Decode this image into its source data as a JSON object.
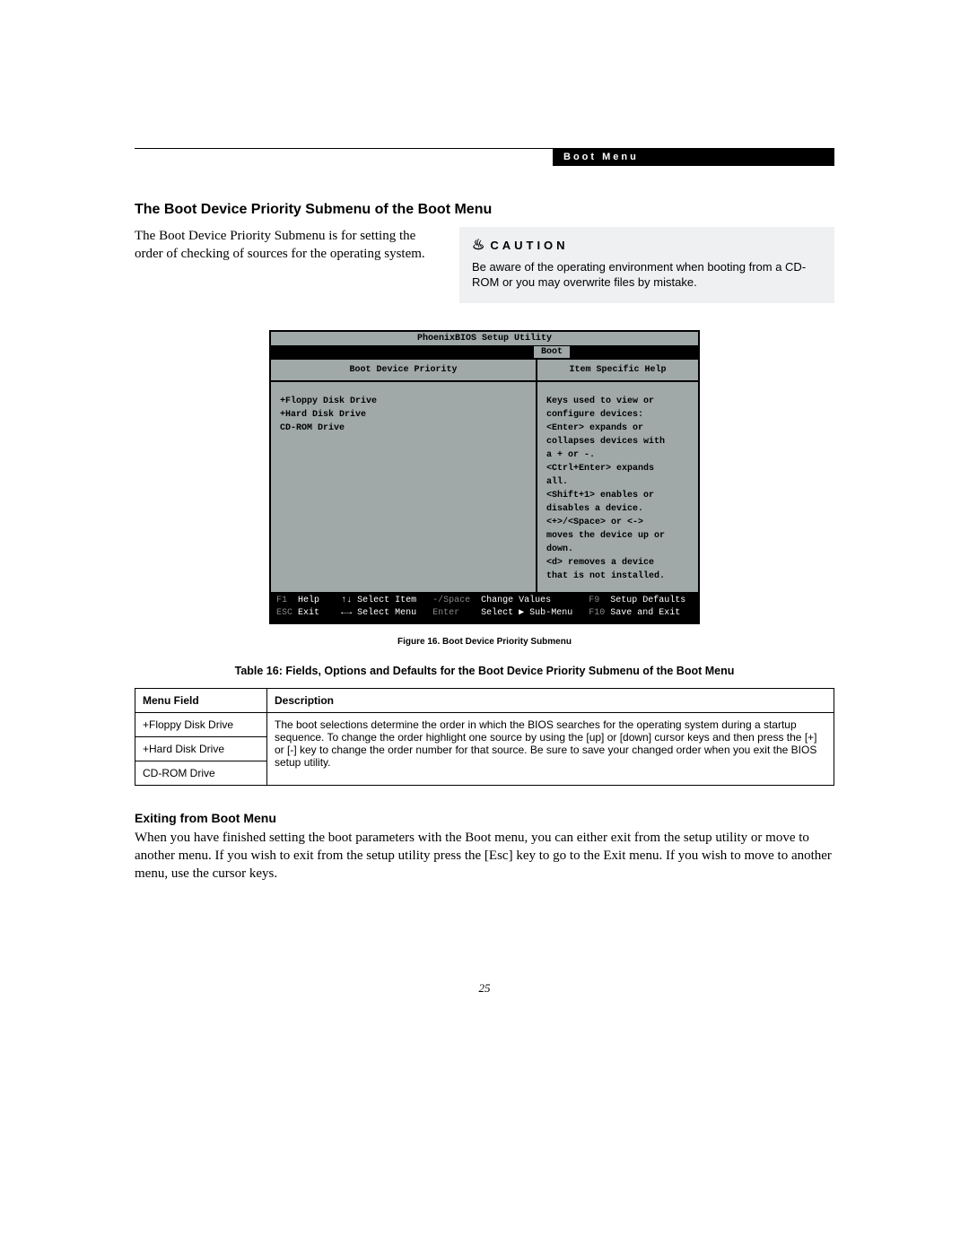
{
  "header": {
    "banner": "Boot Menu"
  },
  "section": {
    "title": "The Boot Device Priority Submenu of the Boot Menu",
    "intro": "The Boot Device Priority Submenu is for setting the order of checking of sources for the operating system."
  },
  "caution": {
    "heading": "CAUTION",
    "body": "Be aware of the operating environment when booting from a CD-ROM or you may overwrite files by mistake."
  },
  "bios": {
    "title": "PhoenixBIOS Setup Utility",
    "tab": "Boot",
    "left_heading": "Boot Device Priority",
    "right_heading": "Item Specific Help",
    "items": [
      "+Floppy Disk Drive",
      "+Hard Disk Drive",
      " CD-ROM Drive"
    ],
    "help": [
      "Keys used to view or",
      "configure devices:",
      "",
      "<Enter> expands or",
      "collapses devices with",
      "a + or -.",
      "<Ctrl+Enter> expands",
      "all.",
      "<Shift+1> enables or",
      "disables a device.",
      "<+>/<Space> or <->",
      "moves the device up or",
      "down.",
      "<d> removes a device",
      "that is not installed."
    ],
    "footer": {
      "line1": {
        "k1": "F1",
        "l1": "Help",
        "k2": "↑↓",
        "l2": "Select Item",
        "k3": "-/Space",
        "l3": "Change Values",
        "k4": "F9",
        "l4": "Setup Defaults"
      },
      "line2": {
        "k1": "ESC",
        "l1": "Exit",
        "k2": "←→",
        "l2": "Select Menu",
        "k3": "Enter",
        "l3": "Select ▶ Sub-Menu",
        "k4": "F10",
        "l4": "Save and Exit"
      }
    }
  },
  "figure_caption": "Figure 16.   Boot Device Priority Submenu",
  "table_caption": "Table 16: Fields, Options and Defaults for the Boot Device Priority Submenu of the Boot Menu",
  "table": {
    "head_field": "Menu Field",
    "head_desc": "Description",
    "fields": [
      "+Floppy Disk Drive",
      "+Hard Disk Drive",
      "CD-ROM Drive"
    ],
    "description": "The boot selections determine the order in which the BIOS searches for the operating system during a startup sequence. To change the order highlight one source by using the [up] or [down] cursor keys and then press the [+] or [-] key to change the order number for that source. Be sure to save your changed order when you exit the BIOS setup utility."
  },
  "exit": {
    "title": "Exiting from Boot Menu",
    "body": "When you have finished setting the boot parameters with the Boot menu, you can either exit from the setup utility or move to another menu. If you wish to exit from the setup utility press the [Esc] key to go to the Exit menu. If you wish to move to another menu, use the cursor keys."
  },
  "page_number": "25"
}
